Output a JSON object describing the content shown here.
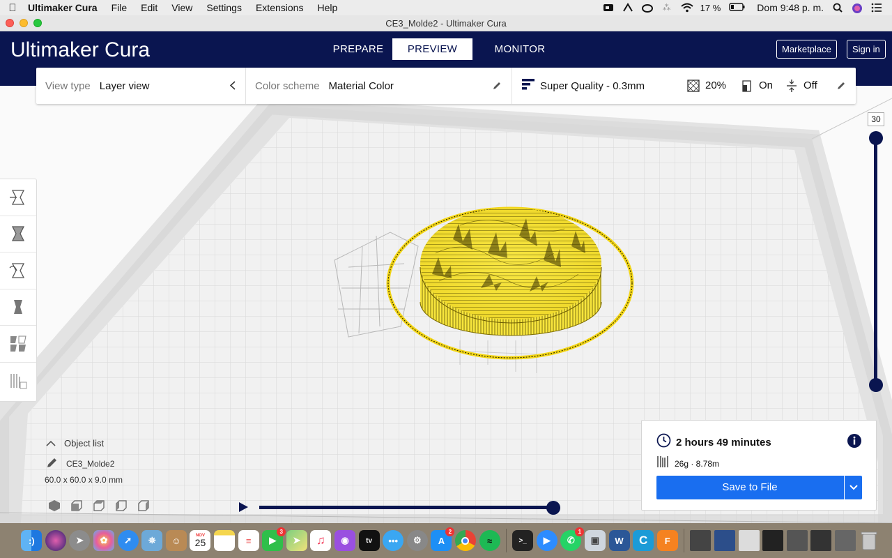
{
  "menubar": {
    "app_name": "Ultimaker Cura",
    "menus": [
      "File",
      "Edit",
      "View",
      "Settings",
      "Extensions",
      "Help"
    ],
    "battery": "17 %",
    "clock": "Dom 9:48 p. m."
  },
  "window": {
    "title": "CE3_Molde2 - Ultimaker Cura"
  },
  "header": {
    "logo_a": "Ultimaker",
    "logo_b": "Cura",
    "stages": [
      "PREPARE",
      "PREVIEW",
      "MONITOR"
    ],
    "active_stage": "PREVIEW",
    "marketplace": "Marketplace",
    "sign_in": "Sign in"
  },
  "toolbar": {
    "view_type_label": "View type",
    "view_type_value": "Layer view",
    "color_scheme_label": "Color scheme",
    "color_scheme_value": "Material Color",
    "profile": "Super Quality - 0.3mm",
    "infill": "20%",
    "support": "On",
    "adhesion": "Off"
  },
  "layer_slider": {
    "current_layer": "30"
  },
  "object_list": {
    "title": "Object list",
    "object_name": "CE3_Molde2",
    "dimensions": "60.0 x 60.0 x 9.0 mm"
  },
  "print_info": {
    "time": "2 hours 49 minutes",
    "material": "26g · 8.78m",
    "save_label": "Save to File"
  },
  "dock": {
    "calendar_month": "NOV",
    "calendar_day": "25",
    "facetime_badge": "3",
    "appstore_badge": "2",
    "whatsapp_badge": "1"
  },
  "colors": {
    "header_bg": "#0a1550",
    "accent_blue": "#196ef0",
    "model_yellow": "#f6e23a"
  }
}
